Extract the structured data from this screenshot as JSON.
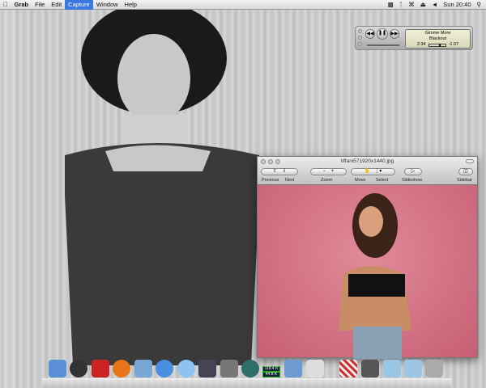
{
  "menubar": {
    "apple": "",
    "app": "Grab",
    "items": [
      "File",
      "Edit",
      "Capture",
      "Window",
      "Help"
    ],
    "active": "Capture",
    "clock": "Sun 20:40"
  },
  "itunes": {
    "track": "Gimme More",
    "artist": "Blackout",
    "elapsed": "2:34",
    "remaining": "-1:37",
    "progress": 0.61
  },
  "preview": {
    "title": "tiffani571920x1440.jpg",
    "toolbar": {
      "previous": "Previous",
      "next": "Next",
      "zoom": "Zoom",
      "move": "Move",
      "select": "Select",
      "slideshow": "Slideshow",
      "sidebar": "Sidebar"
    }
  },
  "dock": {
    "items": [
      "Finder",
      "Dashboard",
      "Front Row",
      "Firefox",
      "Mail",
      "iChat",
      "iTunes",
      "Spaces",
      "System Preferences",
      "Time Machine",
      "Network Monitor",
      "iPhoto",
      "Grab",
      "Stack",
      "Photos Stack",
      "Documents",
      "Downloads",
      "Trash"
    ],
    "net_up": "118.4 K",
    "net_down": "44.8 K"
  }
}
